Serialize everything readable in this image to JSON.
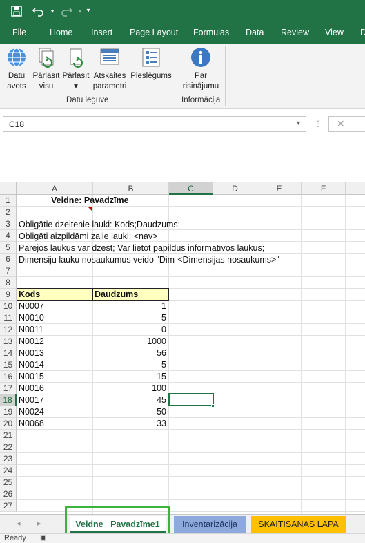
{
  "colors": {
    "brand": "#217346",
    "header_fill": "#ffffc0",
    "tab_inventarizacija": "#8ea9db",
    "tab_skaitisanas": "#ffc000",
    "highlight": "#3cb43c"
  },
  "qat": {
    "icons": [
      "save-icon",
      "undo-icon",
      "redo-icon",
      "customize-icon"
    ]
  },
  "ribbon_tabs": [
    "File",
    "Home",
    "Insert",
    "Page Layout",
    "Formulas",
    "Data",
    "Review",
    "View",
    "D"
  ],
  "ribbon": {
    "group1": {
      "buttons": [
        {
          "line1": "Datu",
          "line2": "avots",
          "icon": "globe-data-icon"
        },
        {
          "line1": "Pārlasīt",
          "line2": "visu",
          "icon": "refresh-all-icon"
        },
        {
          "line1": "Pārlasīt",
          "line2": "▾",
          "icon": "refresh-icon"
        },
        {
          "line1": "Atskaites",
          "line2": "parametri",
          "icon": "report-params-icon"
        },
        {
          "line1": "Pieslēgums",
          "line2": "",
          "icon": "connection-icon"
        }
      ],
      "label": "Datu ieguve"
    },
    "group2": {
      "buttons": [
        {
          "line1": "Par",
          "line2": "risinājumu",
          "icon": "info-icon"
        }
      ],
      "label": "Informācija"
    }
  },
  "formula_bar": {
    "name_box": "C18",
    "cancel_symbol": "✕"
  },
  "grid": {
    "columns": [
      "A",
      "B",
      "C",
      "D",
      "E",
      "F"
    ],
    "selected_column": "C",
    "rows": [
      "1",
      "2",
      "3",
      "4",
      "5",
      "6",
      "7",
      "8",
      "9",
      "10",
      "11",
      "12",
      "13",
      "14",
      "15",
      "16",
      "17",
      "18",
      "19",
      "20",
      "21",
      "22",
      "23",
      "24",
      "25",
      "26",
      "27"
    ],
    "selected_row": "18",
    "title": "Veidne: Pavadzīme",
    "notes": [
      "Obligātie dzeltenie lauki: Kods;Daudzums;",
      "Obligāti aizpildāmi zaļie lauki: <nav>",
      "Pārējos laukus var dzēst; Var lietot papildus informatīvos laukus;",
      "Dimensiju lauku nosaukumus veido \"Dim-<Dimensijas nosaukums>\""
    ],
    "table_headers": [
      "Kods",
      "Daudzums"
    ],
    "table_rows": [
      [
        "N0007",
        "1"
      ],
      [
        "N0010",
        "5"
      ],
      [
        "N0011",
        "0"
      ],
      [
        "N0012",
        "1000"
      ],
      [
        "N0013",
        "56"
      ],
      [
        "N0014",
        "5"
      ],
      [
        "N0015",
        "15"
      ],
      [
        "N0016",
        "100"
      ],
      [
        "N0017",
        "45"
      ],
      [
        "N0024",
        "50"
      ],
      [
        "N0068",
        "33"
      ]
    ]
  },
  "sheet_tabs": [
    "Veidne_ Pavadzīme1",
    "Inventarizācija",
    "SKAITISANAS LAPA"
  ],
  "status": {
    "text": "Ready"
  }
}
